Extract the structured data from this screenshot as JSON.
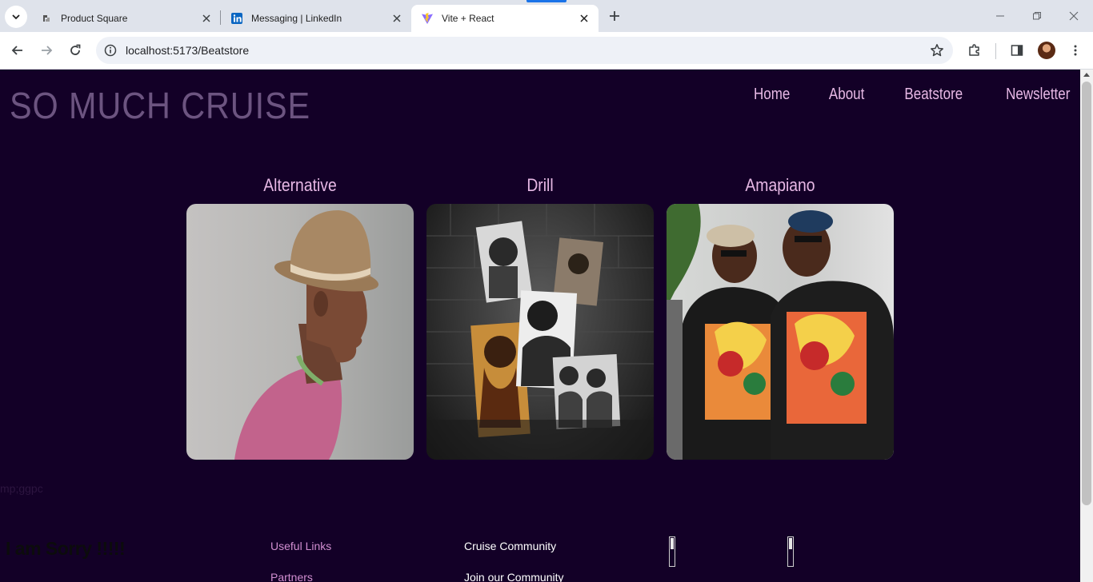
{
  "browser": {
    "tabs": [
      {
        "title": "Product Square",
        "active": false
      },
      {
        "title": "Messaging | LinkedIn",
        "active": false
      },
      {
        "title": "Vite + React",
        "active": true
      }
    ],
    "url": "localhost:5173/Beatstore"
  },
  "site": {
    "logo": "SO MUCH CRUISE",
    "nav": [
      "Home",
      "About",
      "Beatstore",
      "Newsletter"
    ],
    "genres": [
      {
        "label": "Alternative",
        "image": "man-in-hat-profile"
      },
      {
        "label": "Drill",
        "image": "drill-artists-collage"
      },
      {
        "label": "Amapiano",
        "image": "two-men-laughing"
      }
    ],
    "stray_text": "mp;ggpc",
    "sorry_text": "I am Sorry !!!!!",
    "footer": {
      "links_heading": "Useful Links",
      "links_next": "Partners",
      "community_heading": "Cruise Community",
      "community_next": "Join our Community"
    }
  },
  "colors": {
    "page_bg": "#130027",
    "nav_text": "#e7b9e5",
    "logo": "#6c5480",
    "footer_link": "#d18ed0"
  }
}
